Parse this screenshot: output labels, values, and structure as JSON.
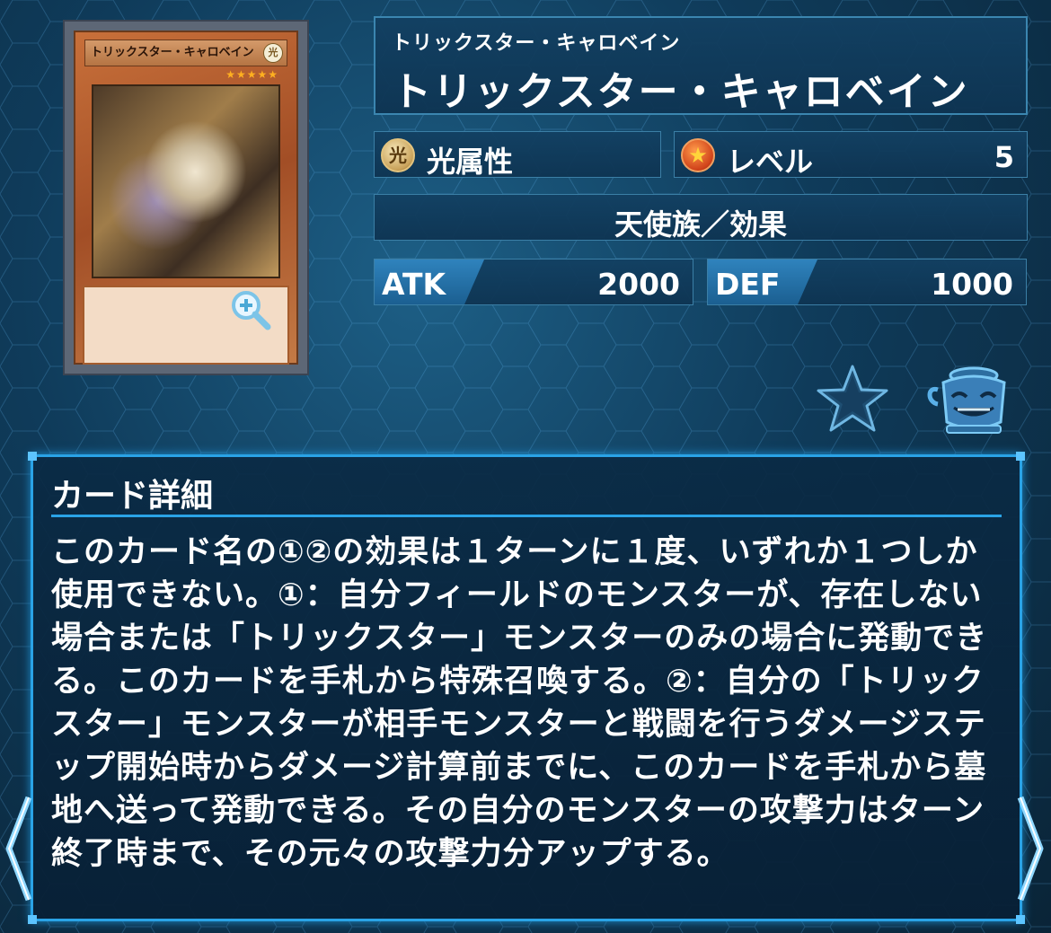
{
  "card": {
    "ruby": "トリックスター・キャロベイン",
    "name": "トリックスター・キャロベイン",
    "image_name_text": "トリックスター・キャロベイン",
    "image_attribute_glyph": "光",
    "image_stars": "★★★★★"
  },
  "attribute": {
    "icon_glyph": "光",
    "label": "光属性"
  },
  "level": {
    "icon_glyph": "★",
    "label": "レベル",
    "value": "5"
  },
  "type_line": "天使族／効果",
  "stats": {
    "atk_label": "ATK",
    "atk_value": "2000",
    "def_label": "DEF",
    "def_value": "1000"
  },
  "detail": {
    "title": "カード詳細",
    "text": "このカード名の①②の効果は１ターンに１度、いずれか１つしか使用できない。①：自分フィールドのモンスターが、存在しない場合または「トリックスター」モンスターのみの場合に発動できる。このカードを手札から特殊召喚する。②：自分の「トリックスター」モンスターが相手モンスターと戦闘を行うダメージステップ開始時からダメージ計算前までに、このカードを手札から墓地へ送って発動できる。その自分のモンスターの攻撃力はターン終了時まで、その元々の攻撃力分アップする。"
  },
  "colors": {
    "accent": "#2aa3e6",
    "panel_border": "#3b7fa6",
    "background": "#0f3b5a"
  },
  "icons": {
    "zoom": "zoom-in-icon",
    "favorite": "star-icon",
    "deck": "pot-icon",
    "prev": "chevron-left-icon",
    "next": "chevron-right-icon"
  }
}
